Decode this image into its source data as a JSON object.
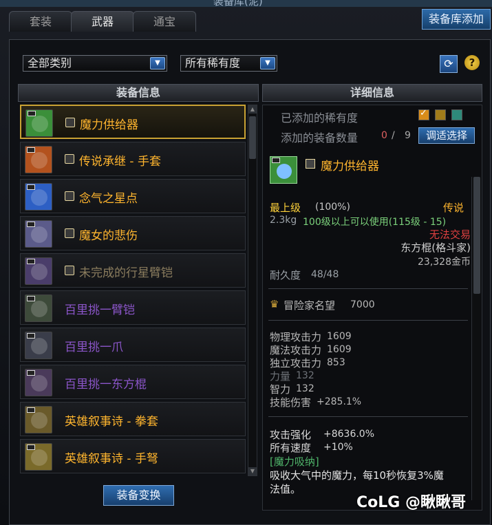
{
  "title": "装备库(泥)",
  "tabs": [
    {
      "label": "套装"
    },
    {
      "label": "武器"
    },
    {
      "label": "通宝"
    }
  ],
  "add_library_label": "装备库添加",
  "filters": {
    "category": "全部类别",
    "rarity": "所有稀有度"
  },
  "toolbar": {
    "refresh_icon": "refresh-icon",
    "help_label": "?"
  },
  "list": {
    "header": "装备信息",
    "items": [
      {
        "name": "魔力供给器",
        "badge": true,
        "style": "orange",
        "icon_color": "#3b8f3a",
        "selected": true
      },
      {
        "name": "传说承继 - 手套",
        "badge": true,
        "style": "orange",
        "icon_color": "#b3521e"
      },
      {
        "name": "念气之星点",
        "badge": true,
        "style": "orange",
        "icon_color": "#2d5fc4"
      },
      {
        "name": "魔女的悲伤",
        "badge": true,
        "style": "orange",
        "icon_color": "#5b5b8a"
      },
      {
        "name": "未完成的行星臂铠",
        "badge": true,
        "style": "gray",
        "icon_color": "#4a3d6a"
      },
      {
        "name": "百里挑一臂铠",
        "badge": false,
        "style": "purple",
        "icon_color": "#3d4a3a"
      },
      {
        "name": "百里挑一爪",
        "badge": false,
        "style": "purple",
        "icon_color": "#3a3d4a"
      },
      {
        "name": "百里挑一东方棍",
        "badge": false,
        "style": "purple",
        "icon_color": "#4a3a5a"
      },
      {
        "name": "英雄叙事诗 - 拳套",
        "badge": false,
        "style": "orange",
        "icon_color": "#6a5a2a"
      },
      {
        "name": "英雄叙事诗 - 手弩",
        "badge": false,
        "style": "orange",
        "icon_color": "#7a6a2a"
      }
    ],
    "transform_label": "装备变换"
  },
  "detail": {
    "header": "详细信息",
    "added_rarity_label": "已添加的稀有度",
    "rarity_swatches": [
      "#d98c1a",
      "#a07b1a",
      "#2e8a7a"
    ],
    "added_count_label": "添加的装备数量",
    "added_count": "0",
    "added_sep": "/",
    "added_total": "9",
    "adjust_label": "调适选择",
    "item_name": "魔力供给器",
    "grade_label": "最上级",
    "grade_pct": "(100%)",
    "rarity_label": "传说",
    "weight": "2.3kg",
    "level_req": "100级以上可以使用(115级 - 15)",
    "trade_status": "无法交易",
    "weapon_type": "东方棍(格斗家)",
    "price": "23,328金币",
    "durability_label": "耐久度",
    "durability": "48/48",
    "fame_label": "冒险家名望",
    "fame_value": "7000",
    "stats": [
      {
        "label": "物理攻击力",
        "value": "1609",
        "dim": false
      },
      {
        "label": "魔法攻击力",
        "value": "1609",
        "dim": false
      },
      {
        "label": "独立攻击力",
        "value": "853",
        "dim": false
      },
      {
        "label": "力量",
        "value": "132",
        "dim": true
      },
      {
        "label": "智力",
        "value": "132",
        "dim": false
      },
      {
        "label": "技能伤害",
        "value": "+285.1%",
        "dim": false
      }
    ],
    "attack_boost_label": "攻击强化",
    "attack_boost_value": "+8636.0%",
    "speed_label": "所有速度",
    "speed_value": "+10%",
    "skill_tag": "[魔力吸纳]",
    "skill_desc_1": "吸收大气中的魔力，每10秒恢复3%魔",
    "skill_desc_2": "法值。"
  },
  "watermark": "CoLG @瞅瞅哥",
  "colors": {
    "accent_blue": "#2f6db0",
    "legend_orange": "#ffb52e",
    "green_text": "#7bd17b",
    "red_text": "#e04040"
  }
}
